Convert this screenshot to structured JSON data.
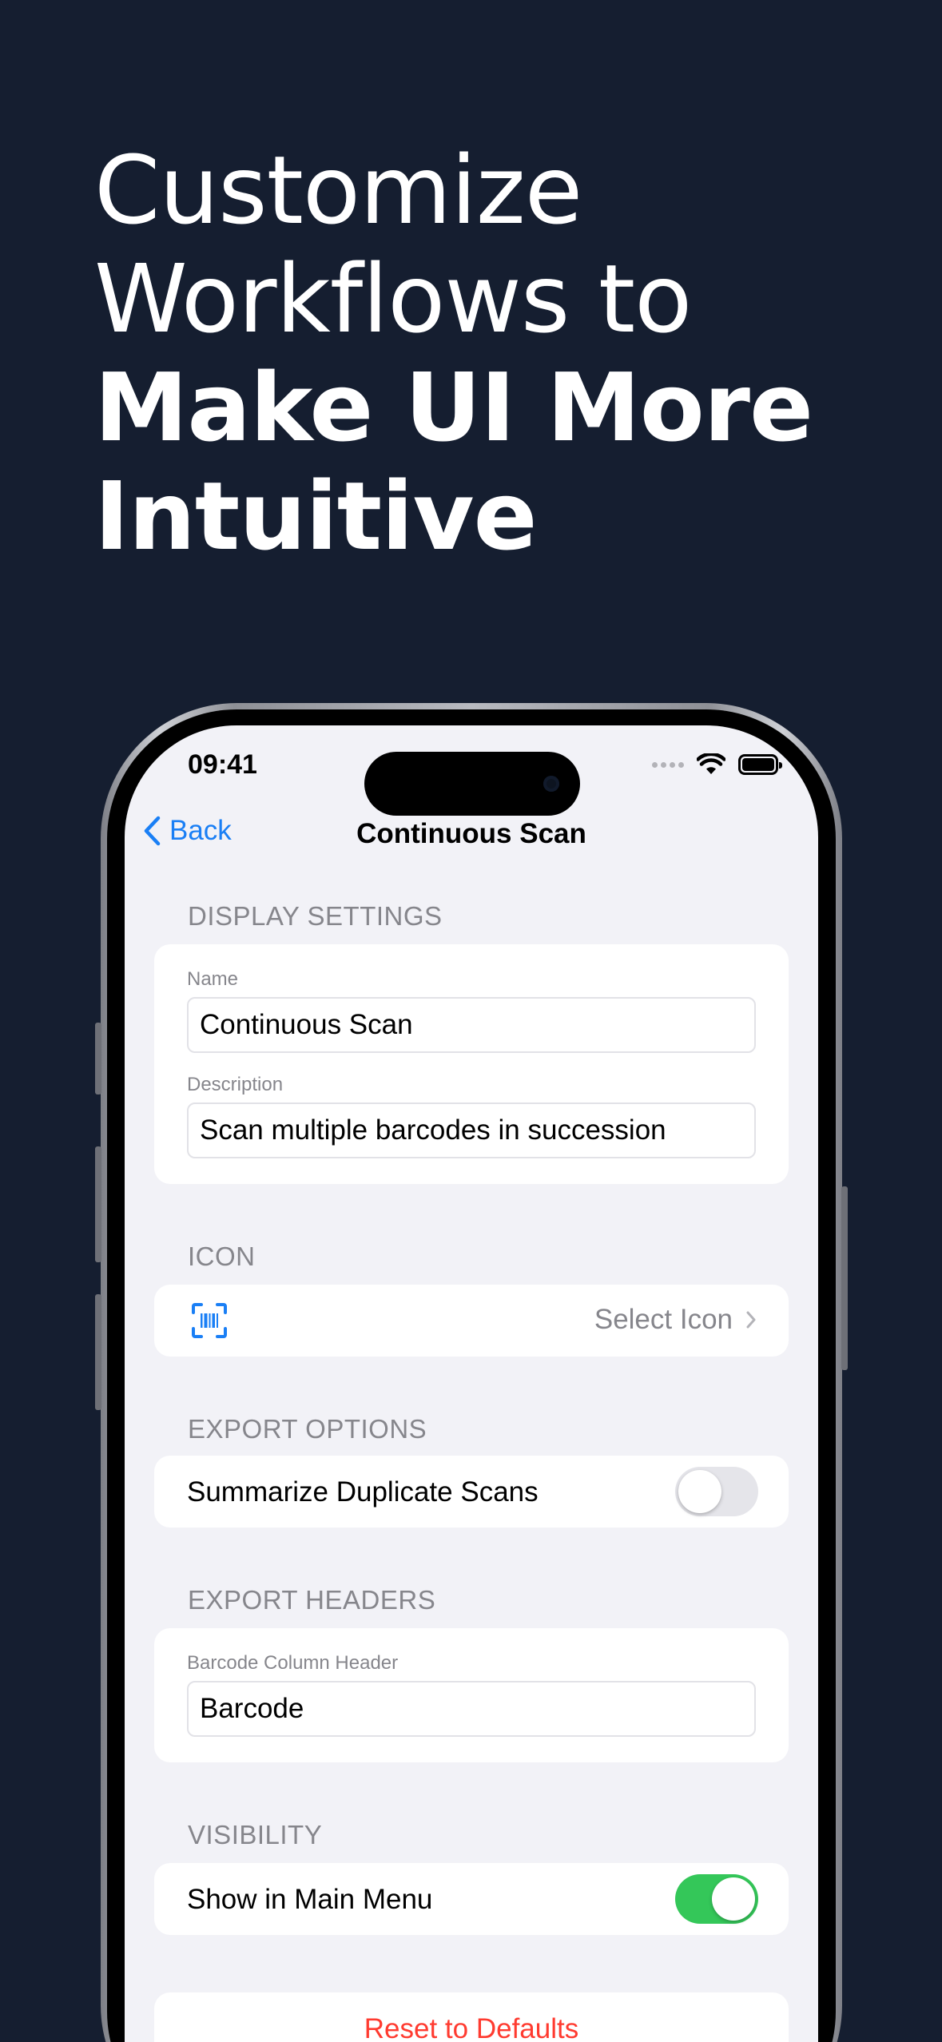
{
  "headline": {
    "line1": "Customize",
    "line2": "Workflows to",
    "line3": "Make UI More",
    "line4": "Intuitive"
  },
  "status_bar": {
    "time": "09:41"
  },
  "nav": {
    "back_label": "Back",
    "title": "Continuous Scan"
  },
  "display_settings": {
    "header": "DISPLAY SETTINGS",
    "name_label": "Name",
    "name_value": "Continuous Scan",
    "description_label": "Description",
    "description_value": "Scan multiple barcodes in succession"
  },
  "icon_section": {
    "header": "ICON",
    "current_icon": "barcode-viewfinder-icon",
    "select_label": "Select Icon"
  },
  "export_options": {
    "header": "EXPORT OPTIONS",
    "summarize_label": "Summarize Duplicate Scans",
    "summarize_enabled": false
  },
  "export_headers": {
    "header": "EXPORT HEADERS",
    "barcode_label": "Barcode Column Header",
    "barcode_value": "Barcode"
  },
  "visibility": {
    "header": "VISIBILITY",
    "show_label": "Show in Main Menu",
    "show_enabled": true
  },
  "reset": {
    "label": "Reset to Defaults"
  },
  "colors": {
    "background": "#151e30",
    "accent": "#1a7ff5",
    "toggle_on": "#34c759",
    "destructive": "#ff3b30"
  }
}
